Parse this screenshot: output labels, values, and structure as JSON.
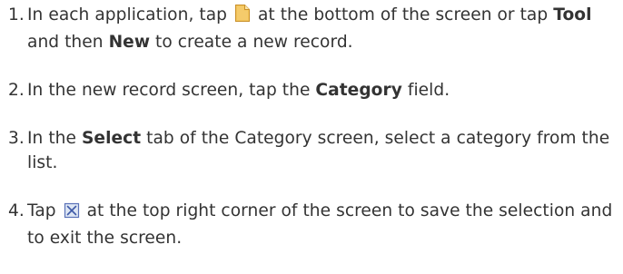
{
  "steps": [
    {
      "number": "1.",
      "seg1": "In each application, tap",
      "icon": "new-record-file-icon",
      "seg2": "at the bottom of the screen or tap",
      "bold1": "Tool",
      "seg3": "and then",
      "bold2": "New",
      "seg4": "to create a new record."
    },
    {
      "number": "2.",
      "seg1": "In the new record screen, tap the",
      "bold1": "Category",
      "seg2": "field."
    },
    {
      "number": "3.",
      "seg1": "In the",
      "bold1": "Select",
      "seg2": "tab of the Category screen, select a category from the list."
    },
    {
      "number": "4.",
      "seg1": "Tap",
      "icon": "close-save-icon",
      "seg2": "at the top right corner of the screen to save the selection and to exit the screen."
    }
  ],
  "colors": {
    "text": "#333333",
    "file_icon_fill": "#f2c45a",
    "close_icon_fill": "#dde6f4",
    "close_icon_stroke": "#5a72b8"
  }
}
